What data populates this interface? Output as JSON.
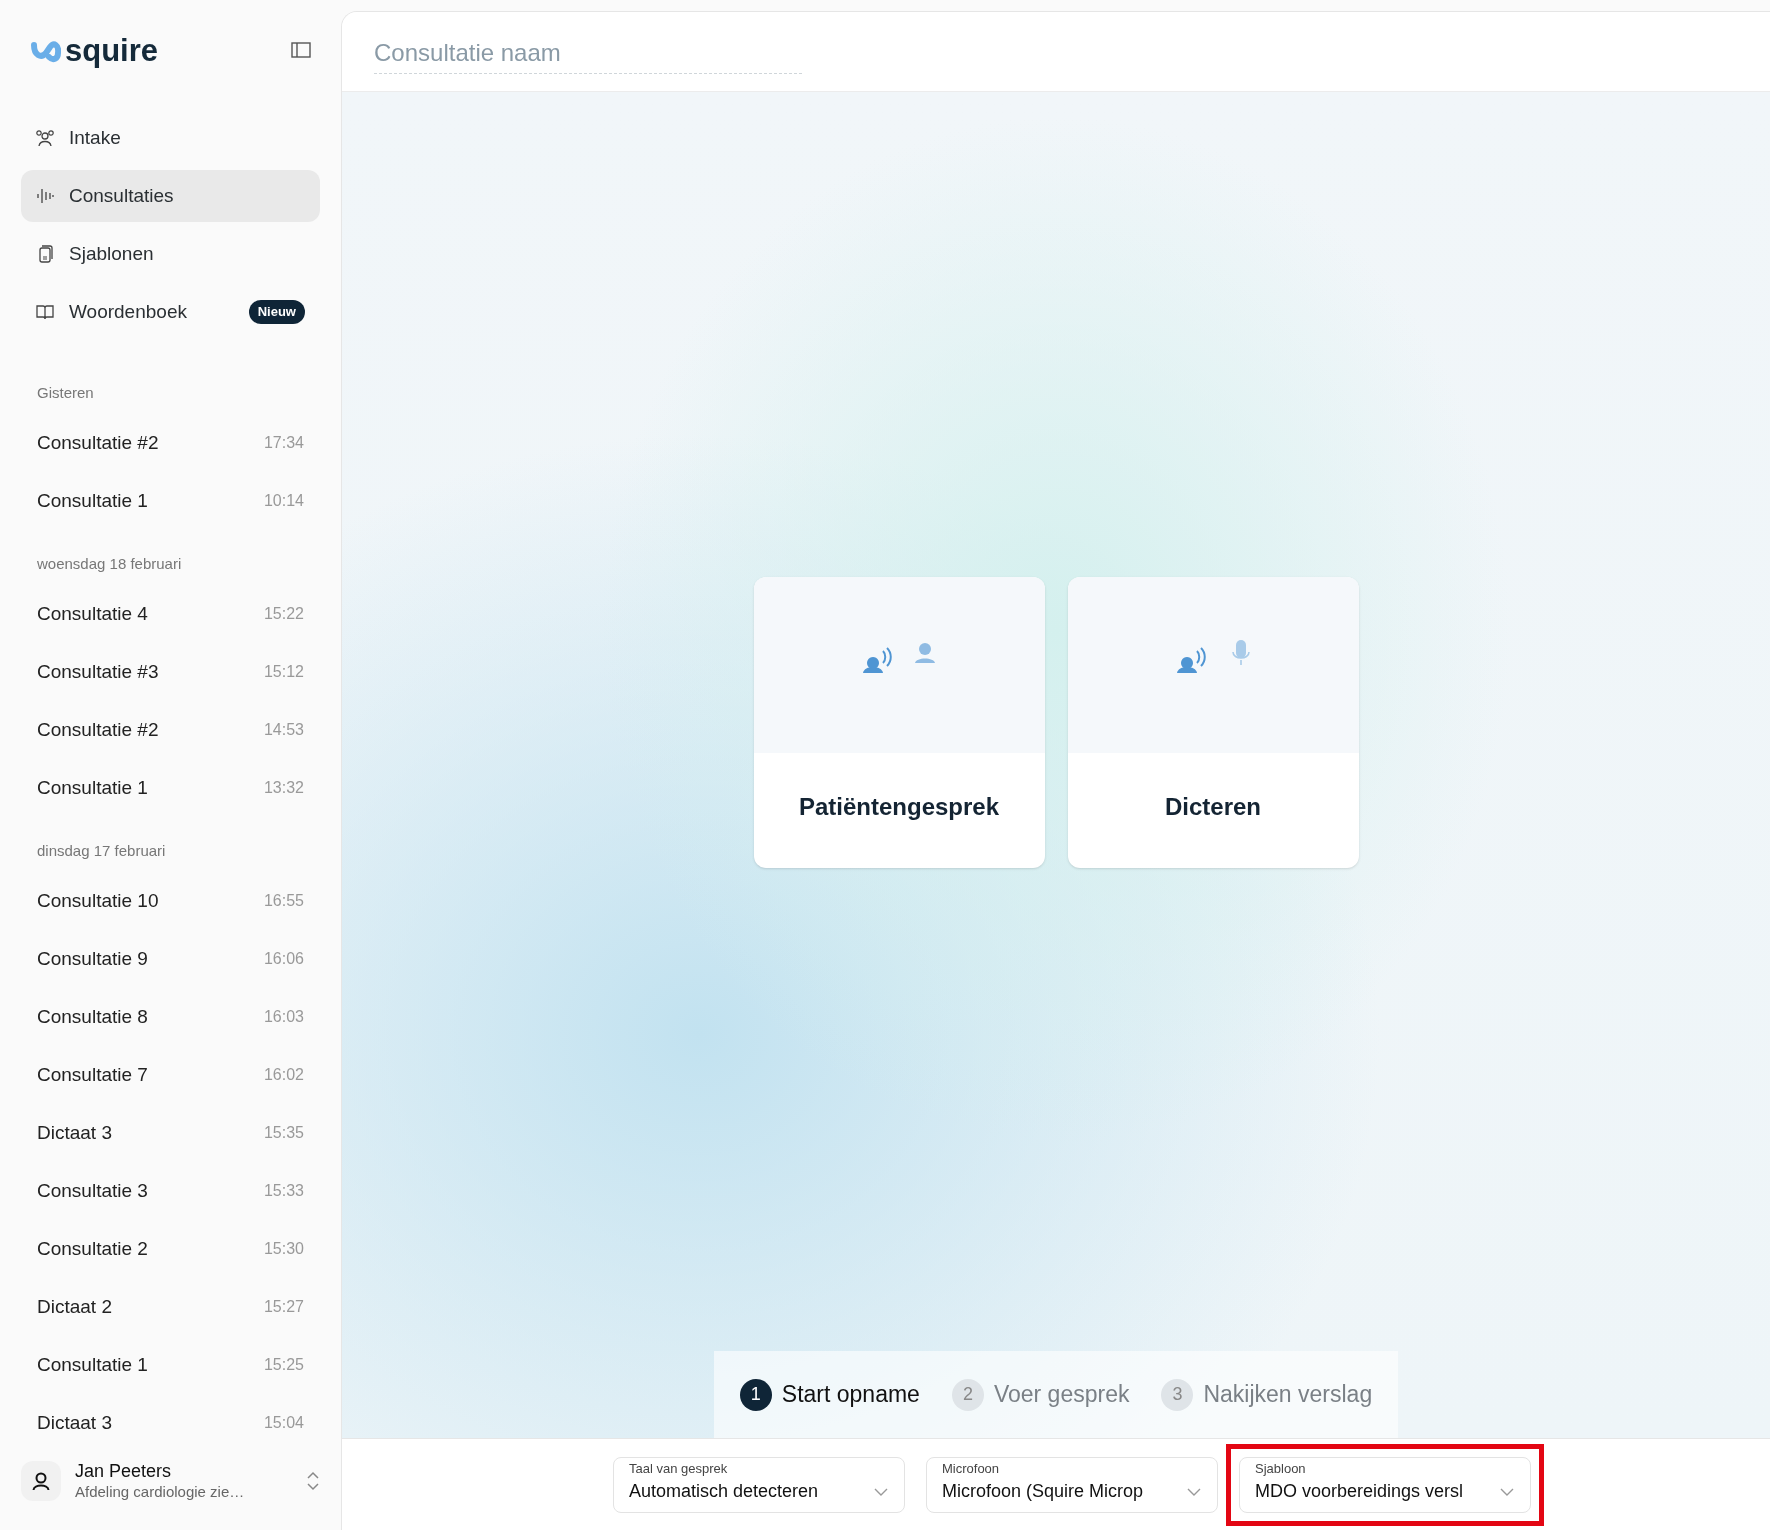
{
  "sidebar": {
    "logo": "squire",
    "nav_items": [
      {
        "label": "Intake",
        "selected": false
      },
      {
        "label": "Consultaties",
        "selected": true
      },
      {
        "label": "Sjablonen",
        "selected": false
      },
      {
        "label": "Woordenboek",
        "selected": false,
        "badge": "Nieuw"
      }
    ],
    "groups": [
      {
        "heading": "Gisteren",
        "items": [
          {
            "title": "Consultatie #2",
            "time": "17:34"
          },
          {
            "title": "Consultatie 1",
            "time": "10:14"
          }
        ]
      },
      {
        "heading": "woensdag 18 februari",
        "items": [
          {
            "title": "Consultatie 4",
            "time": "15:22"
          },
          {
            "title": "Consultatie #3",
            "time": "15:12"
          },
          {
            "title": "Consultatie #2",
            "time": "14:53"
          },
          {
            "title": "Consultatie 1",
            "time": "13:32"
          }
        ]
      },
      {
        "heading": "dinsdag 17 februari",
        "items": [
          {
            "title": "Consultatie 10",
            "time": "16:55"
          },
          {
            "title": "Consultatie 9",
            "time": "16:06"
          },
          {
            "title": "Consultatie 8",
            "time": "16:03"
          },
          {
            "title": "Consultatie 7",
            "time": "16:02"
          },
          {
            "title": "Dictaat 3",
            "time": "15:35"
          },
          {
            "title": "Consultatie 3",
            "time": "15:33"
          },
          {
            "title": "Consultatie 2",
            "time": "15:30"
          },
          {
            "title": "Dictaat 2",
            "time": "15:27"
          },
          {
            "title": "Consultatie 1",
            "time": "15:25"
          },
          {
            "title": "Dictaat 3",
            "time": "15:04"
          }
        ]
      }
    ],
    "user": {
      "name": "Jan Peeters",
      "department": "Afdeling cardiologie zie…"
    }
  },
  "header": {
    "name_field": {
      "placeholder": "Consultatie naam"
    }
  },
  "mode_cards": [
    {
      "label": "Patiëntengesprek"
    },
    {
      "label": "Dicteren"
    }
  ],
  "steps": [
    {
      "number": "1",
      "label": "Start opname",
      "selected": true
    },
    {
      "number": "2",
      "label": "Voer gesprek",
      "selected": false
    },
    {
      "number": "3",
      "label": "Nakijken verslag",
      "selected": false
    }
  ],
  "dropdowns": [
    {
      "label": "Taal van gesprek",
      "value": "Automatisch detecteren",
      "highlighted": false
    },
    {
      "label": "Microfoon",
      "value": "Microfoon (Squire Microp",
      "highlighted": false
    },
    {
      "label": "Sjabloon",
      "value": "MDO voorbereidings versl",
      "highlighted": true
    }
  ]
}
